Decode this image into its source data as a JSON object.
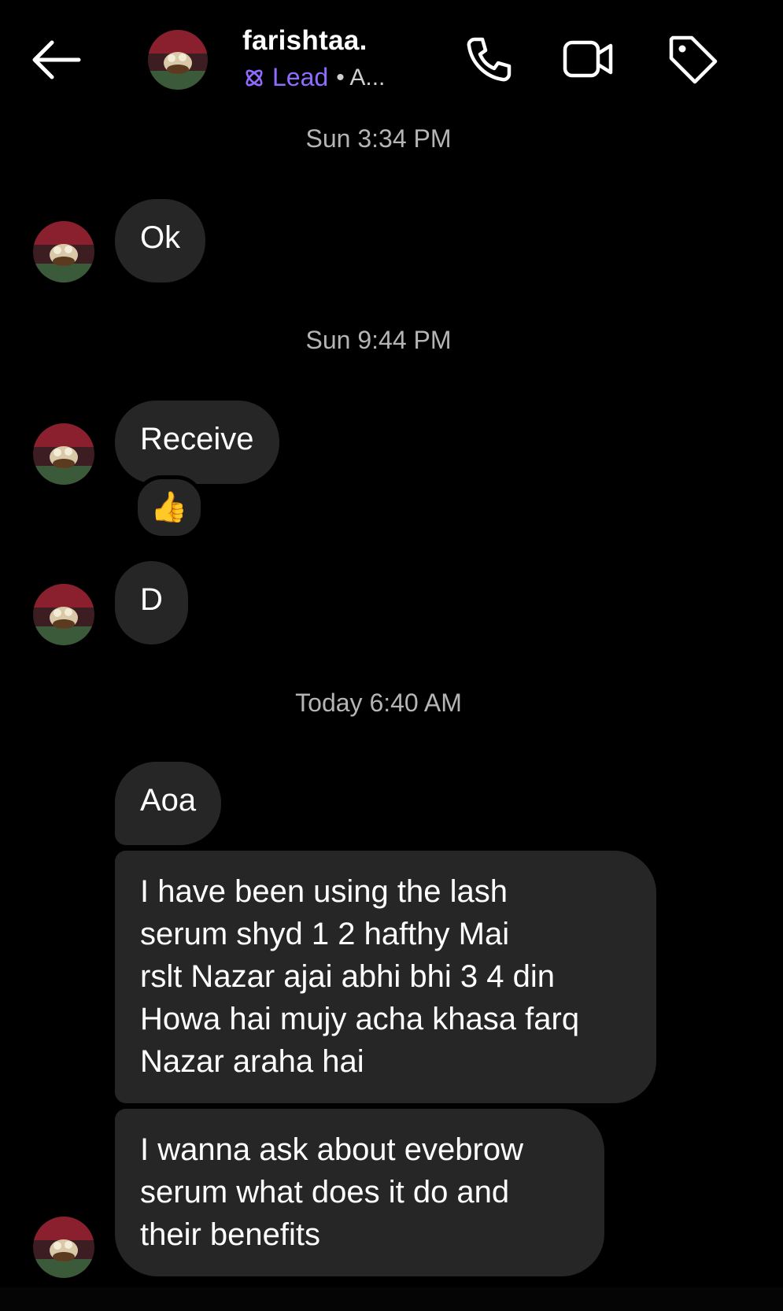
{
  "header": {
    "name": "farishtaa.",
    "label": "Lead",
    "status": "• A..."
  },
  "colors": {
    "background": "#000000",
    "bubble": "#262626",
    "lead_accent": "#8f6bff",
    "timestamp": "#b5b5b5"
  },
  "icons": [
    "back-arrow-icon",
    "phone-icon",
    "video-camera-icon",
    "tag-icon",
    "lead-atom-icon"
  ],
  "timestamps": [
    "Sun 3:34 PM",
    "Sun 9:44 PM",
    "Today 6:40 AM"
  ],
  "messages": [
    {
      "text": "Ok"
    },
    {
      "text": "Receive",
      "reaction": "👍"
    },
    {
      "text": "D"
    },
    {
      "text": "Aoa"
    },
    {
      "lines": [
        "I have been using the lash",
        "serum shyd 1 2 hafthy Mai",
        "rslt Nazar ajai abhi bhi 3 4 din",
        "Howa hai mujy acha khasa farq",
        "Nazar araha hai"
      ]
    },
    {
      "lines": [
        "I wanna ask about evebrow",
        "serum what does it do and",
        "their benefits"
      ]
    }
  ]
}
